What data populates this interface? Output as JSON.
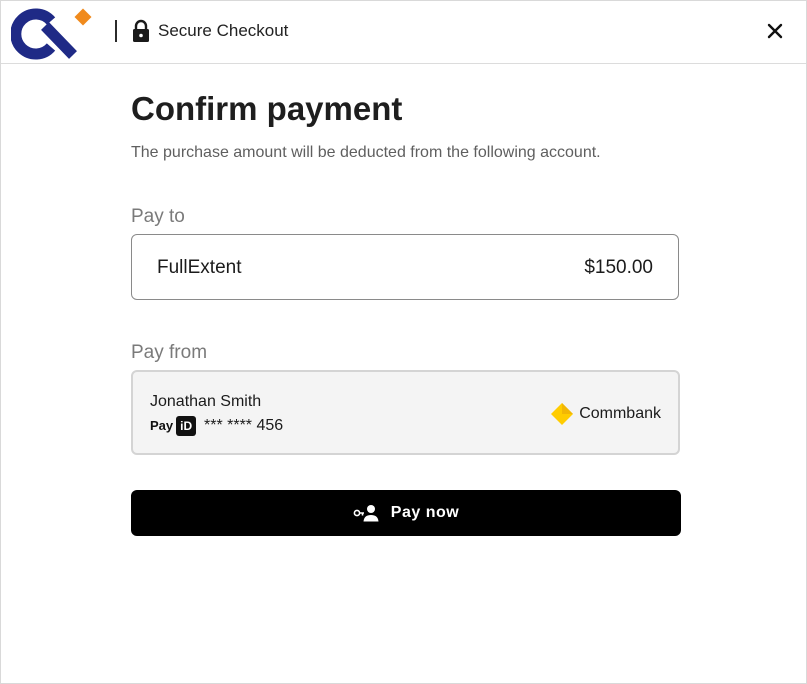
{
  "header": {
    "logo_icon": "brand-logo-icon",
    "lock_icon": "lock-icon",
    "secure_label": "Secure Checkout",
    "close_icon": "close-icon",
    "brand_colors": {
      "navy": "#1f2a86",
      "orange": "#f08a1c"
    }
  },
  "main": {
    "title": "Confirm payment",
    "subtitle": "The purchase amount will be deducted from the following account."
  },
  "pay_to": {
    "label": "Pay to",
    "merchant": "FullExtent",
    "amount": "$150.00"
  },
  "pay_from": {
    "label": "Pay from",
    "account_name": "Jonathan Smith",
    "payid_text": "Pay",
    "payid_badge": "iD",
    "account_number": "*** **** 456",
    "bank_icon": "commbank-diamond-icon",
    "bank_name": "Commbank",
    "bank_color": "#ffcc00"
  },
  "action": {
    "pay_icon": "person-key-icon",
    "pay_label": "Pay now"
  }
}
